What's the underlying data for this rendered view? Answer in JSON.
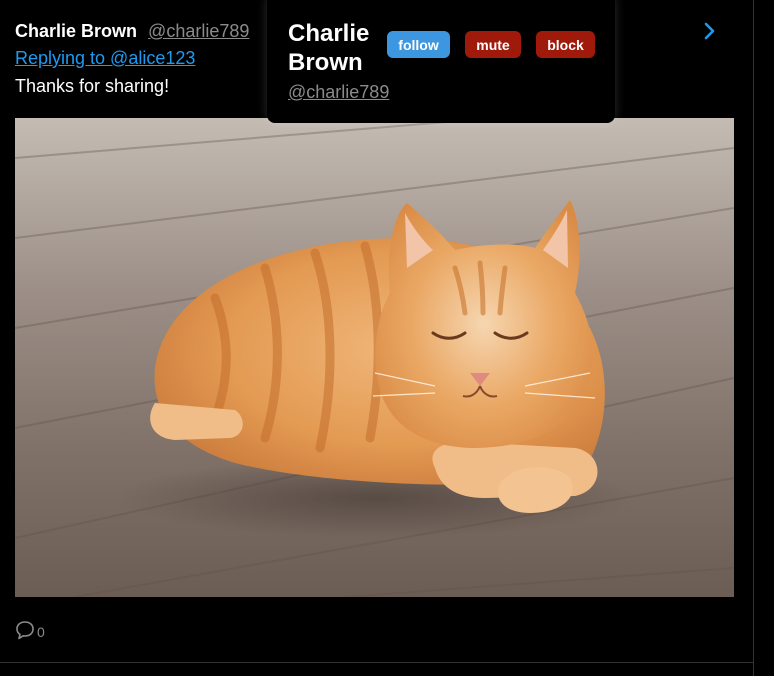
{
  "post": {
    "display_name": "Charlie Brown",
    "handle": "@charlie789",
    "replying_to": "Replying to @alice123",
    "text": "Thanks for sharing!",
    "reply_count": "0",
    "media_icon": "orange-tabby-cat-photo"
  },
  "hover_card": {
    "display_name": "Charlie Brown",
    "handle": "@charlie789",
    "follow_label": "follow",
    "mute_label": "mute",
    "block_label": "block"
  },
  "colors": {
    "link": "#1d9bf0",
    "muted": "#8b8b8b",
    "follow": "#3d96e0",
    "danger": "#a01a0c",
    "background": "#000000"
  },
  "icons": {
    "expand": "chevron-right-icon",
    "reply": "speech-bubble-icon"
  }
}
